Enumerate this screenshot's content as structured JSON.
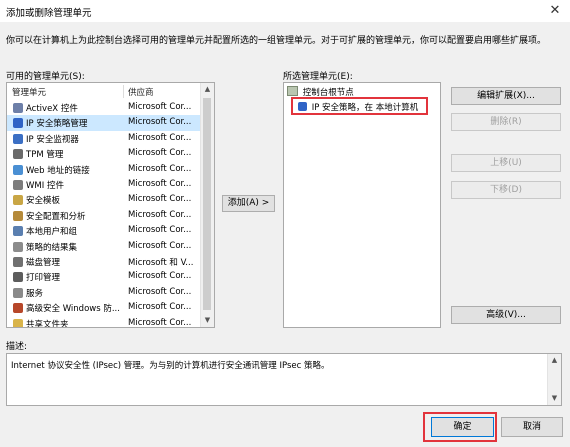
{
  "window": {
    "title": "添加或删除管理单元",
    "close_glyph": "✕"
  },
  "intro": "你可以在计算机上为此控制台选择可用的管理单元并配置所选的一组管理单元。对于可扩展的管理单元，你可以配置要启用哪些扩展项。",
  "available": {
    "label": "可用的管理单元(S):",
    "columns": [
      "管理单元",
      "供应商"
    ],
    "rows": [
      {
        "name": "ActiveX 控件",
        "vendor": "Microsoft Cor...",
        "icon": "activex-icon",
        "color": "#6d7fa8"
      },
      {
        "name": "IP 安全策略管理",
        "vendor": "Microsoft Cor...",
        "icon": "ip-security-policy-icon",
        "color": "#2f63c6"
      },
      {
        "name": "IP 安全监视器",
        "vendor": "Microsoft Cor...",
        "icon": "ip-security-monitor-icon",
        "color": "#3b6fc4"
      },
      {
        "name": "TPM 管理",
        "vendor": "Microsoft Cor...",
        "icon": "tpm-icon",
        "color": "#6b6b6b"
      },
      {
        "name": "Web 地址的链接",
        "vendor": "Microsoft Cor...",
        "icon": "web-link-icon",
        "color": "#4a8fd3"
      },
      {
        "name": "WMI 控件",
        "vendor": "Microsoft Cor...",
        "icon": "wmi-icon",
        "color": "#7d7d7d"
      },
      {
        "name": "安全模板",
        "vendor": "Microsoft Cor...",
        "icon": "security-template-icon",
        "color": "#c9a645"
      },
      {
        "name": "安全配置和分析",
        "vendor": "Microsoft Cor...",
        "icon": "security-config-icon",
        "color": "#b58a3a"
      },
      {
        "name": "本地用户和组",
        "vendor": "Microsoft Cor...",
        "icon": "local-users-icon",
        "color": "#5a7fb0"
      },
      {
        "name": "策略的结果集",
        "vendor": "Microsoft Cor...",
        "icon": "policy-result-icon",
        "color": "#8c8c8c"
      },
      {
        "name": "磁盘管理",
        "vendor": "Microsoft 和 V...",
        "icon": "disk-management-icon",
        "color": "#707070"
      },
      {
        "name": "打印管理",
        "vendor": "Microsoft Cor...",
        "icon": "print-management-icon",
        "color": "#5d5d5d"
      },
      {
        "name": "服务",
        "vendor": "Microsoft Cor...",
        "icon": "services-icon",
        "color": "#8a8a8a"
      },
      {
        "name": "高级安全 Windows 防...",
        "vendor": "Microsoft Cor...",
        "icon": "firewall-icon",
        "color": "#b7472a"
      },
      {
        "name": "共享文件夹",
        "vendor": "Microsoft Cor...",
        "icon": "shared-folder-icon",
        "color": "#d9b44a"
      }
    ]
  },
  "add_button": "添加(A) >",
  "selected": {
    "label": "所选管理单元(E):",
    "root": "控制台根节点",
    "child": "IP 安全策略，在 本地计算机"
  },
  "buttons": {
    "edit_extensions": "编辑扩展(X)...",
    "remove": "删除(R)",
    "move_up": "上移(U)",
    "move_down": "下移(D)",
    "advanced": "高级(V)...",
    "ok": "确定",
    "cancel": "取消"
  },
  "description": {
    "label": "描述:",
    "text": "Internet 协议安全性 (IPsec) 管理。为与别的计算机进行安全通讯管理 IPsec 策略。"
  },
  "colors": {
    "selection": "#cce8ff",
    "highlight": "#e2343c",
    "accent": "#0078d7"
  }
}
